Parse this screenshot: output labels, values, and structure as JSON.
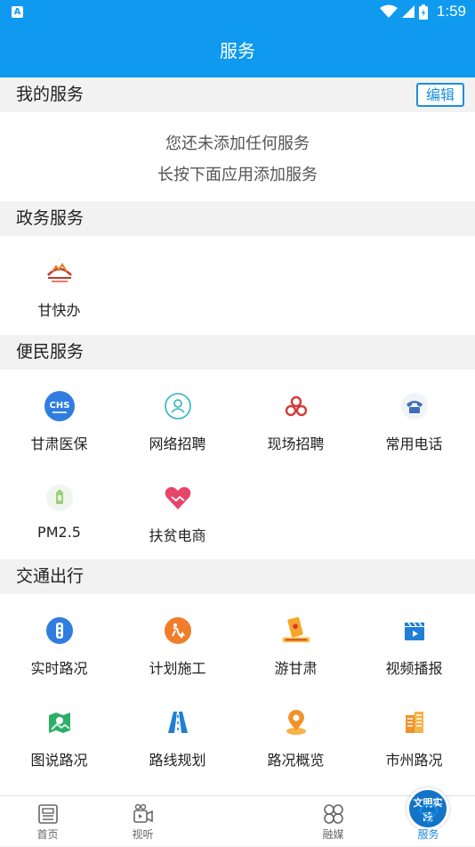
{
  "status_bar": {
    "time": "1:59",
    "app_icon": "A"
  },
  "title": "服务",
  "my_services": {
    "header": "我的服务",
    "edit_label": "编辑",
    "empty_line1": "您还未添加任何服务",
    "empty_line2": "长按下面应用添加服务"
  },
  "gov_services": {
    "header": "政务服务",
    "items": [
      {
        "label": "甘快办",
        "icon": "gankuaiban-logo-icon"
      }
    ]
  },
  "convenience_services": {
    "header": "便民服务",
    "items": [
      {
        "label": "甘肃医保",
        "icon": "chs-medical-insurance-icon"
      },
      {
        "label": "网络招聘",
        "icon": "online-recruitment-icon"
      },
      {
        "label": "现场招聘",
        "icon": "onsite-recruitment-icon"
      },
      {
        "label": "常用电话",
        "icon": "telephone-icon"
      },
      {
        "label": "PM2.5",
        "icon": "pm25-icon"
      },
      {
        "label": "扶贫电商",
        "icon": "handshake-heart-icon"
      }
    ]
  },
  "traffic": {
    "header": "交通出行",
    "items": [
      {
        "label": "实时路况",
        "icon": "traffic-light-icon"
      },
      {
        "label": "计划施工",
        "icon": "construction-icon"
      },
      {
        "label": "游甘肃",
        "icon": "tour-gansu-icon"
      },
      {
        "label": "视频播报",
        "icon": "video-clapper-icon"
      },
      {
        "label": "图说路况",
        "icon": "map-image-icon"
      },
      {
        "label": "路线规划",
        "icon": "road-route-icon"
      },
      {
        "label": "路况概览",
        "icon": "location-pin-icon"
      },
      {
        "label": "市州路况",
        "icon": "city-buildings-icon"
      }
    ]
  },
  "tabs": [
    {
      "label": "首页",
      "icon": "newspaper-icon"
    },
    {
      "label": "视听",
      "icon": "video-camera-icon"
    },
    {
      "label": "文明实践",
      "icon": "civilization-practice-icon"
    },
    {
      "label": "融媒",
      "icon": "grid-circles-icon"
    },
    {
      "label": "服务",
      "icon": "diamond-heart-icon"
    }
  ],
  "colors": {
    "primary": "#0f9af0",
    "accent": "#1a8fe0"
  }
}
